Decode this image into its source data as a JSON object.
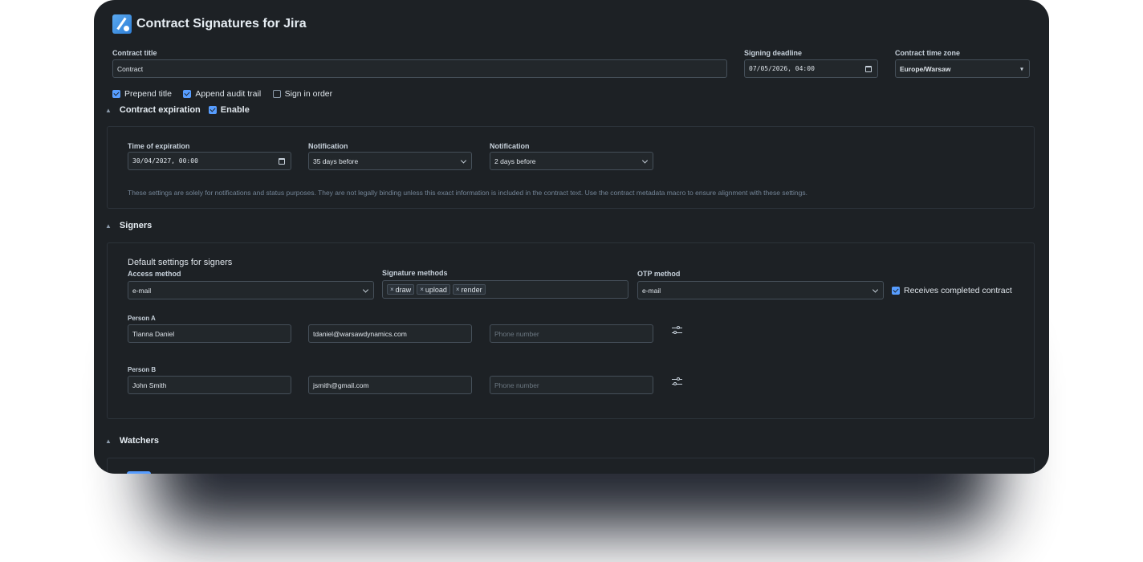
{
  "app": {
    "title": "Contract Signatures for Jira"
  },
  "contract": {
    "title_label": "Contract title",
    "title_value": "Contract",
    "deadline_label": "Signing deadline",
    "deadline_value": "07/05/2026, 04:00",
    "timezone_label": "Contract time zone",
    "timezone_value": "Europe/Warsaw"
  },
  "options": {
    "prepend_title": "Prepend title",
    "append_audit_trail": "Append audit trail",
    "sign_in_order": "Sign in order"
  },
  "expiration": {
    "section_title": "Contract expiration",
    "enable_label": "Enable",
    "time_label": "Time of expiration",
    "time_value": "30/04/2027, 00:00",
    "notification1_label": "Notification",
    "notification1_value": "35 days before",
    "notification2_label": "Notification",
    "notification2_value": "2 days before",
    "note": "These settings are solely for notifications and status purposes. They are not legally binding unless this exact information is included in the contract text. Use the contract metadata macro to ensure alignment with these settings."
  },
  "signers": {
    "section_title": "Signers",
    "defaults_title": "Default settings for signers",
    "access_label": "Access method",
    "access_value": "e-mail",
    "methods_label": "Signature methods",
    "methods": [
      "draw",
      "upload",
      "render"
    ],
    "otp_label": "OTP method",
    "otp_value": "e-mail",
    "receives_completed": "Receives completed contract",
    "persons": [
      {
        "label": "Person A",
        "name": "Tianna Daniel",
        "email": "tdaniel@warsawdynamics.com",
        "phone_placeholder": "Phone number"
      },
      {
        "label": "Person B",
        "name": "John Smith",
        "email": "jsmith@gmail.com",
        "phone_placeholder": "Phone number"
      }
    ]
  },
  "watchers": {
    "section_title": "Watchers"
  },
  "icons": {
    "logo": "signature-logo-icon",
    "calendar": "calendar-icon",
    "chevron": "chevron-down-icon",
    "collapse": "triangle-up-icon",
    "settings": "sliders-icon",
    "remove": "close-icon"
  },
  "colors": {
    "accent": "#579dff",
    "background": "#1d2125"
  }
}
